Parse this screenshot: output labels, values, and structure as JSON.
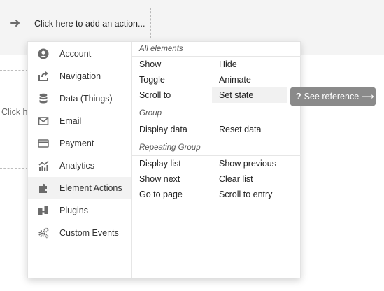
{
  "canvas": {
    "action_slot_label": "Click here to add an action...",
    "background_text": "Click h"
  },
  "categories": [
    {
      "label": "Account",
      "icon": "account-icon"
    },
    {
      "label": "Navigation",
      "icon": "navigation-icon"
    },
    {
      "label": "Data (Things)",
      "icon": "database-icon"
    },
    {
      "label": "Email",
      "icon": "email-icon"
    },
    {
      "label": "Payment",
      "icon": "credit-card-icon"
    },
    {
      "label": "Analytics",
      "icon": "analytics-icon"
    },
    {
      "label": "Element Actions",
      "icon": "element-actions-icon",
      "selected": true
    },
    {
      "label": "Plugins",
      "icon": "plugins-icon"
    },
    {
      "label": "Custom Events",
      "icon": "gears-icon"
    }
  ],
  "sections": [
    {
      "title": "All elements",
      "actions": [
        "Show",
        "Hide",
        "Toggle",
        "Animate",
        "Scroll to",
        "Set state"
      ]
    },
    {
      "title": "Group",
      "actions": [
        "Display data",
        "Reset data"
      ]
    },
    {
      "title": "Repeating Group",
      "actions": [
        "Display list",
        "Show previous",
        "Show next",
        "Clear list",
        "Go to page",
        "Scroll to entry"
      ]
    }
  ],
  "highlighted_action": "Set state",
  "tooltip": {
    "label": "See reference ⟶",
    "icon": "question-icon",
    "icon_glyph": "?"
  },
  "colors": {
    "tooltip_bg": "#8a8a8a",
    "selected_bg": "#f2f2f2",
    "icon_gray": "#6b6b6b"
  }
}
